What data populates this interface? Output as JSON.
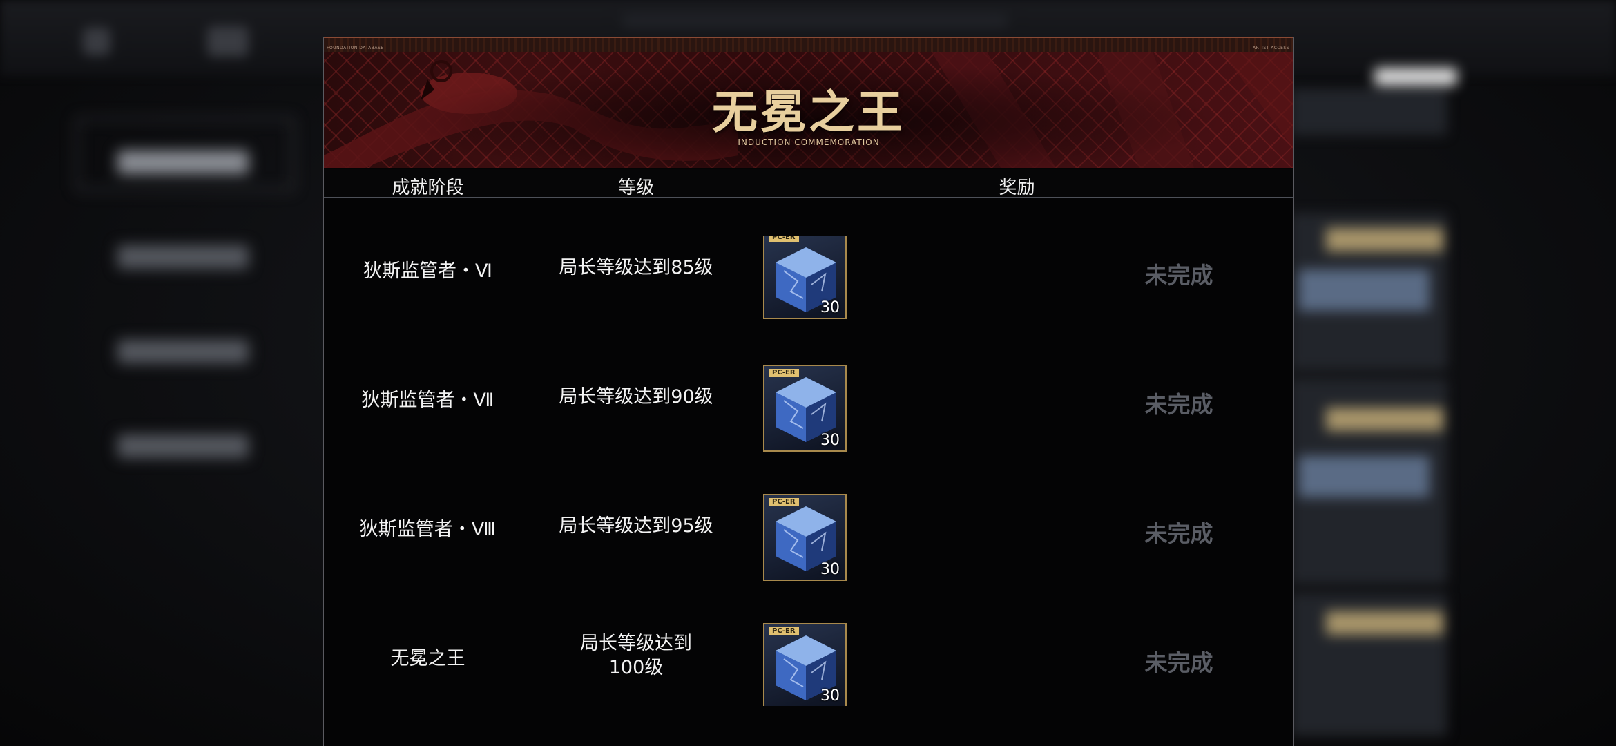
{
  "banner": {
    "title": "无冕之王",
    "subtitle": "INDUCTION COMMEMORATION",
    "strip_left": "FOUNDATION DATABASE",
    "strip_right": "ARTIST ACCESS"
  },
  "columns": {
    "stage": "成就阶段",
    "level": "等级",
    "reward": "奖励"
  },
  "rows": [
    {
      "stage": "狄斯监管者・Ⅵ",
      "level": "局长等级达到85级",
      "reward_badge": "PC-ER",
      "reward_qty": "30",
      "reward_icon": "blue-crystal-cube-icon",
      "status": "未完成"
    },
    {
      "stage": "狄斯监管者・Ⅶ",
      "level": "局长等级达到90级",
      "reward_badge": "PC-ER",
      "reward_qty": "30",
      "reward_icon": "blue-crystal-cube-icon",
      "status": "未完成"
    },
    {
      "stage": "狄斯监管者・Ⅷ",
      "level": "局长等级达到95级",
      "reward_badge": "PC-ER",
      "reward_qty": "30",
      "reward_icon": "blue-crystal-cube-icon",
      "status": "未完成"
    },
    {
      "stage": "无冕之王",
      "level_line1": "局长等级达到",
      "level_line2": "100级",
      "reward_badge": "PC-ER",
      "reward_qty": "30",
      "reward_icon": "blue-crystal-cube-icon",
      "status": "未完成"
    }
  ],
  "colors": {
    "title_gold": "#e8cf9e",
    "reward_border": "#a8894c",
    "status_gray": "#5a5d65",
    "banner_red": "#3d0e10"
  }
}
